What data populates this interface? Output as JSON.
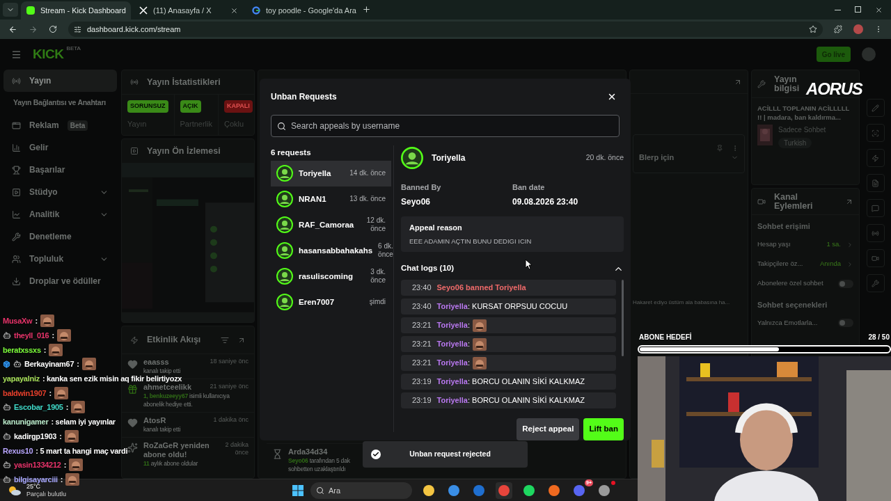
{
  "browser": {
    "tabs": [
      {
        "title": "Stream - Kick Dashboard",
        "selected": true
      },
      {
        "title": "(11) Anasayfa / X",
        "selected": false
      },
      {
        "title": "toy poodle - Google'da Ara",
        "selected": false
      }
    ],
    "url": "dashboard.kick.com/stream"
  },
  "header": {
    "logo": "KICK",
    "logo_badge": "BETA",
    "go_live": "Go live"
  },
  "sidebar": {
    "items": [
      {
        "label": "Yayın",
        "selected": true,
        "expandable": false,
        "children": [
          {
            "label": "Yayın Bağlantısı ve Anahtarı",
            "selected": false
          }
        ]
      },
      {
        "label": "Reklam",
        "badge": "Beta",
        "selected": false,
        "expandable": false
      },
      {
        "label": "Gelir",
        "selected": false,
        "expandable": false
      },
      {
        "label": "Başarılar",
        "selected": false,
        "expandable": false
      },
      {
        "label": "Stüdyo",
        "selected": false,
        "expandable": true
      },
      {
        "label": "Analitik",
        "selected": false,
        "expandable": true
      },
      {
        "label": "Denetleme",
        "selected": false,
        "expandable": false
      },
      {
        "label": "Topluluk",
        "selected": false,
        "expandable": true
      },
      {
        "label": "Droplar ve ödüller",
        "selected": false,
        "expandable": false
      }
    ]
  },
  "stats": {
    "title": "Yayın İstatistikleri",
    "items": [
      {
        "badge": "SORUNSUZ",
        "label": "Yayın",
        "ok": true
      },
      {
        "badge": "AÇIK",
        "label": "Partnerlik",
        "ok": true
      },
      {
        "badge": "KAPALI",
        "label": "Çoklu",
        "ok": false
      }
    ]
  },
  "preview": {
    "title": "Yayın Ön İzlemesi"
  },
  "activity": {
    "title": "Etkinlik Akışı",
    "events": [
      {
        "kind": "follow",
        "name": "eaasss",
        "time": "18 saniye önc",
        "text": "kanalı takip etti"
      },
      {
        "kind": "gift",
        "name": "ahmetceelikk",
        "time": "21 saniye önc",
        "highlight": "1, benkuzeeyy67",
        "text": "isimli kullanıcıya abonelik hediye etti."
      },
      {
        "kind": "follow",
        "name": "AtosR",
        "time": "1 dakika önc",
        "text": "kanalı takip etti"
      },
      {
        "kind": "resub",
        "name": "RoZaGeR yeniden abone oldu!",
        "time": "2 dakika önce",
        "highlight": "11",
        "text": "aylık abone oldular"
      }
    ]
  },
  "moderation": {
    "event": {
      "kind": "timeout",
      "name": "Arda34d34",
      "highlight": "Seyo06",
      "text": "tarafından 5 dak",
      "note": "sohbetten uzaklaştırıldı"
    }
  },
  "chat": {
    "pinned": "Blerp için",
    "faded_message": "Hakaret ediyo üstüm ala babasına ha..."
  },
  "stream_info": {
    "title": "Yayın bilgisi",
    "stream_title": "ACİLLL TOPLANIN ACİLLLLL !! | madara, ban kaldırma...",
    "category": "Sadece Sohbet",
    "tag": "Turkish"
  },
  "channel_actions": {
    "title": "Kanal Eylemleri",
    "sections": [
      {
        "title": "Sohbet erişimi",
        "rows": [
          {
            "kind": "value",
            "label": "Hesap yaşı",
            "value": "1 sa."
          },
          {
            "kind": "value",
            "label": "Takipçilere öz...",
            "value": "Anında"
          },
          {
            "kind": "toggle",
            "label": "Abonelere özel sohbet",
            "on": false
          }
        ]
      },
      {
        "title": "Sohbet seçenekleri",
        "rows": [
          {
            "kind": "toggle",
            "label": "Yalnızca Emotlarla...",
            "on": false
          }
        ]
      }
    ]
  },
  "overlay_chat": {
    "messages": [
      {
        "user": "MusaXw",
        "color": "#e8336a",
        "bot_badge": false,
        "cube_badge": false,
        "kind": "emote",
        "text": ":"
      },
      {
        "user": "theyll_016",
        "color": "#e8336a",
        "bot_badge": true,
        "cube_badge": false,
        "kind": "emote",
        "text": ":"
      },
      {
        "user": "beratxssxs",
        "color": "#7dff3a",
        "bot_badge": false,
        "cube_badge": false,
        "kind": "emote",
        "text": ":"
      },
      {
        "user": "Berkayinam67",
        "color": "#ffffff",
        "bot_badge": true,
        "cube_badge": true,
        "kind": "emote",
        "text": ":"
      },
      {
        "user": "yapayalniz",
        "color": "#a8e05a",
        "bot_badge": false,
        "cube_badge": false,
        "kind": "text",
        "text": ": kanka sen ezik misin aq fikir belirtiyozx"
      },
      {
        "user": "baldwin1907",
        "color": "#e8402c",
        "bot_badge": false,
        "cube_badge": false,
        "kind": "emote",
        "text": ":"
      },
      {
        "user": "Escobar_1905",
        "color": "#3fd9c8",
        "bot_badge": true,
        "cube_badge": false,
        "kind": "emote",
        "text": ":"
      },
      {
        "user": "kanunigamer",
        "color": "#b8e8c8",
        "bot_badge": false,
        "cube_badge": false,
        "kind": "text",
        "text": ": selam iyi yayınlar"
      },
      {
        "user": "kadirgp1903",
        "color": "#ffffff",
        "bot_badge": true,
        "cube_badge": false,
        "kind": "emote",
        "text": ":"
      },
      {
        "user": "Rexus10",
        "color": "#b9a6ff",
        "bot_badge": false,
        "cube_badge": false,
        "kind": "text",
        "text": ": 5 mart ta hangi maç vardi"
      },
      {
        "user": "yasin1334212",
        "color": "#e8336a",
        "bot_badge": true,
        "cube_badge": false,
        "kind": "emote",
        "text": ":"
      },
      {
        "user": "bilgisayarciii",
        "color": "#a8a8ff",
        "bot_badge": true,
        "cube_badge": false,
        "kind": "emote",
        "text": ":"
      }
    ]
  },
  "overlay_logo": "AORUS",
  "sub_goal": {
    "title": "ABONE HEDEFİ",
    "count": "28 / 50",
    "level": 0.56
  },
  "modal": {
    "title": "Unban Requests",
    "search": {
      "placeholder": "Search appeals by username"
    },
    "count": "6 requests",
    "requests": [
      {
        "name": "Toriyella",
        "time": "14 dk. önce",
        "selected": true
      },
      {
        "name": "NRAN1",
        "time": "13 dk. önce",
        "selected": false
      },
      {
        "name": "RAF_Camoraa",
        "time": "12 dk. önce",
        "selected": false
      },
      {
        "name": "hasansabbahakahs",
        "time": "6 dk. önce",
        "selected": false
      },
      {
        "name": "rasuliscoming",
        "time": "3 dk. önce",
        "selected": false
      },
      {
        "name": "Eren7007",
        "time": "şimdi",
        "selected": false
      }
    ],
    "detail": {
      "name": "Toriyella",
      "time": "20 dk. önce",
      "banned_by_label": "Banned By",
      "banned_by": "Seyo06",
      "date_label": "Ban date",
      "date": "09.08.2026 23:40",
      "appeal_label": "Appeal reason",
      "appeal": "EEE ADAMIN AÇTIN BUNU DEDIGI ICIN",
      "logs_title": "Chat logs (10)",
      "logs_expanded": true,
      "logs": [
        {
          "kind": "system",
          "time": "23:40",
          "text": "Seyo06 banned Toriyella"
        },
        {
          "kind": "message",
          "time": "23:40",
          "user": "Toriyella",
          "text": ": KURSAT ORPSUU COCUU"
        },
        {
          "kind": "emote",
          "time": "23:21",
          "user": "Toriyella",
          "text": ":"
        },
        {
          "kind": "emote",
          "time": "23:21",
          "user": "Toriyella",
          "text": ":"
        },
        {
          "kind": "emote",
          "time": "23:21",
          "user": "Toriyella",
          "text": ":"
        },
        {
          "kind": "message",
          "time": "23:19",
          "user": "Toriyella",
          "text": ": BORCU OLANIN SİKİ KALKMAZ"
        },
        {
          "kind": "message",
          "time": "23:19",
          "user": "Toriyella",
          "text": ": BORCU OLANIN SİKİ KALKMAZ"
        }
      ]
    },
    "buttons": {
      "reject": "Reject appeal",
      "lift": "Lift ban"
    }
  },
  "toast": "Unban request rejected",
  "taskbar": {
    "temperature": "25°C",
    "weather": "Parçalı bulutlu",
    "search": {
      "placeholder": "Ara"
    },
    "discord_badge": "9+"
  }
}
